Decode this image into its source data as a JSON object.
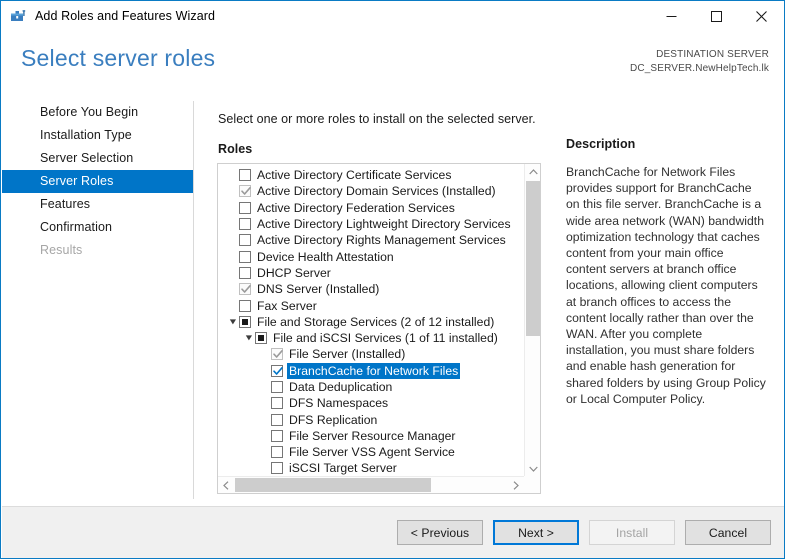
{
  "window": {
    "title": "Add Roles and Features Wizard",
    "icon": "server-wizard-icon",
    "minimize_label": "—",
    "maximize_label": "□",
    "close_label": "✕",
    "accent_color": "#0a7bc4"
  },
  "header": {
    "page_title": "Select server roles",
    "destination_label": "DESTINATION SERVER",
    "destination_value": "DC_SERVER.NewHelpTech.lk",
    "title_color": "#3a7ebf"
  },
  "sidebar": {
    "selected_color": "#0075c8",
    "items": [
      {
        "label": "Before You Begin",
        "state": "normal"
      },
      {
        "label": "Installation Type",
        "state": "normal"
      },
      {
        "label": "Server Selection",
        "state": "normal"
      },
      {
        "label": "Server Roles",
        "state": "selected"
      },
      {
        "label": "Features",
        "state": "normal"
      },
      {
        "label": "Confirmation",
        "state": "normal"
      },
      {
        "label": "Results",
        "state": "disabled"
      }
    ]
  },
  "main": {
    "instruction": "Select one or more roles to install on the selected server.",
    "roles_label": "Roles",
    "roles": [
      {
        "label": "Active Directory Certificate Services",
        "indent": 0,
        "checkbox": "unchecked",
        "expander": "none"
      },
      {
        "label": "Active Directory Domain Services (Installed)",
        "indent": 0,
        "checkbox": "checked-disabled",
        "expander": "none"
      },
      {
        "label": "Active Directory Federation Services",
        "indent": 0,
        "checkbox": "unchecked",
        "expander": "none"
      },
      {
        "label": "Active Directory Lightweight Directory Services",
        "indent": 0,
        "checkbox": "unchecked",
        "expander": "none"
      },
      {
        "label": "Active Directory Rights Management Services",
        "indent": 0,
        "checkbox": "unchecked",
        "expander": "none"
      },
      {
        "label": "Device Health Attestation",
        "indent": 0,
        "checkbox": "unchecked",
        "expander": "none"
      },
      {
        "label": "DHCP Server",
        "indent": 0,
        "checkbox": "unchecked",
        "expander": "none"
      },
      {
        "label": "DNS Server (Installed)",
        "indent": 0,
        "checkbox": "checked-disabled",
        "expander": "none"
      },
      {
        "label": "Fax Server",
        "indent": 0,
        "checkbox": "unchecked",
        "expander": "none"
      },
      {
        "label": "File and Storage Services (2 of 12 installed)",
        "indent": 0,
        "checkbox": "partial",
        "expander": "expanded"
      },
      {
        "label": "File and iSCSI Services (1 of 11 installed)",
        "indent": 1,
        "checkbox": "partial",
        "expander": "expanded"
      },
      {
        "label": "File Server (Installed)",
        "indent": 2,
        "checkbox": "checked-disabled",
        "expander": "none"
      },
      {
        "label": "BranchCache for Network Files",
        "indent": 2,
        "checkbox": "checked",
        "expander": "none",
        "selected": true
      },
      {
        "label": "Data Deduplication",
        "indent": 2,
        "checkbox": "unchecked",
        "expander": "none"
      },
      {
        "label": "DFS Namespaces",
        "indent": 2,
        "checkbox": "unchecked",
        "expander": "none"
      },
      {
        "label": "DFS Replication",
        "indent": 2,
        "checkbox": "unchecked",
        "expander": "none"
      },
      {
        "label": "File Server Resource Manager",
        "indent": 2,
        "checkbox": "unchecked",
        "expander": "none"
      },
      {
        "label": "File Server VSS Agent Service",
        "indent": 2,
        "checkbox": "unchecked",
        "expander": "none"
      },
      {
        "label": "iSCSI Target Server",
        "indent": 2,
        "checkbox": "unchecked",
        "expander": "none"
      }
    ],
    "description_title": "Description",
    "description_body": "BranchCache for Network Files provides support for BranchCache on this file server. BranchCache is a wide area network (WAN) bandwidth optimization technology that caches content from your main office content servers at branch office locations, allowing client computers at branch offices to access the content locally rather than over the WAN. After you complete installation, you must share folders and enable hash generation for shared folders by using Group Policy or Local Computer Policy."
  },
  "footer": {
    "previous_label": "< Previous",
    "next_label": "Next >",
    "install_label": "Install",
    "cancel_label": "Cancel",
    "focus_color": "#0078d7"
  }
}
